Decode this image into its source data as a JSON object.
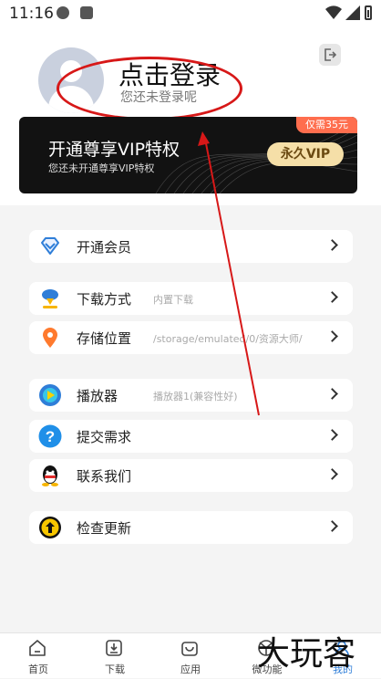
{
  "status_bar": {
    "time": "11:16"
  },
  "login": {
    "title": "点击登录",
    "subtitle": "您还未登录呢"
  },
  "vip": {
    "title": "开通尊享VIP特权",
    "subtitle": "您还未开通尊享VIP特权",
    "badge": "仅需35元",
    "button": "永久VIP"
  },
  "menu": [
    {
      "name": "vip-member",
      "label": "开通会员",
      "value": "",
      "icon": "diamond-icon"
    },
    {
      "name": "download-method",
      "label": "下载方式",
      "value": "内置下载",
      "icon": "download-icon"
    },
    {
      "name": "storage-location",
      "label": "存储位置",
      "value": "/storage/emulated/0/资源大师/",
      "icon": "location-pin-icon"
    },
    {
      "name": "player",
      "label": "播放器",
      "value": "播放器1(兼容性好)",
      "icon": "play-icon"
    },
    {
      "name": "submit-request",
      "label": "提交需求",
      "value": "",
      "icon": "question-icon"
    },
    {
      "name": "contact-us",
      "label": "联系我们",
      "value": "",
      "icon": "qq-icon"
    },
    {
      "name": "check-update",
      "label": "检查更新",
      "value": "",
      "icon": "update-icon"
    }
  ],
  "bottom_nav": [
    {
      "label": "首页",
      "icon": "home-icon"
    },
    {
      "label": "下载",
      "icon": "download-tray-icon"
    },
    {
      "label": "应用",
      "icon": "bag-icon"
    },
    {
      "label": "微功能",
      "icon": "tool-icon"
    },
    {
      "label": "我的",
      "icon": "user-icon",
      "active": true
    }
  ],
  "watermark": "大玩客",
  "colors": {
    "accent": "#2f7ed8",
    "annotation": "#d71818",
    "vip_gold": "#f5dfa8",
    "badge": "#ff6e4e"
  }
}
